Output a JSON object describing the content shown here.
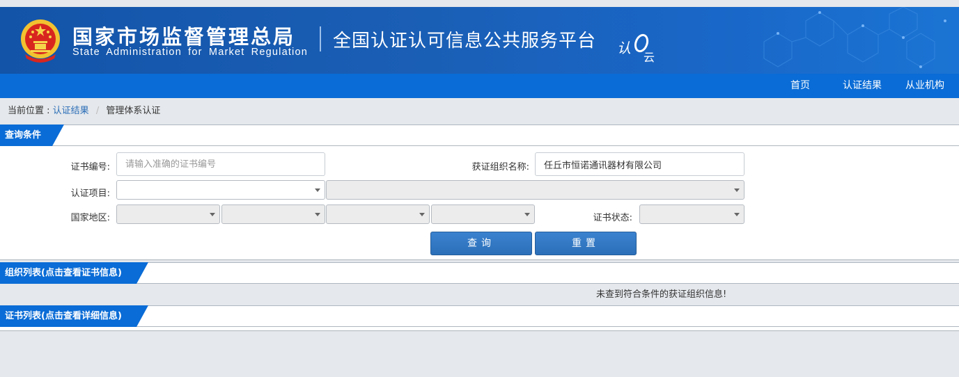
{
  "header": {
    "org_name_cn": "国家市场监督管理总局",
    "org_name_en": "State Administration for Market Regulation",
    "platform_name": "全国认证认可信息公共服务平台",
    "logo_text": "认云"
  },
  "nav": {
    "items": [
      {
        "label": "首页"
      },
      {
        "label": "认证结果"
      },
      {
        "label": "从业机构"
      }
    ]
  },
  "breadcrumb": {
    "prefix": "当前位置 :",
    "link": "认证结果",
    "separator": "/",
    "current": "管理体系认证"
  },
  "query": {
    "title": "查询条件",
    "cert_no_label": "证书编号:",
    "cert_no_placeholder": "请输入准确的证书编号",
    "org_name_label": "获证组织名称:",
    "org_name_value": "任丘市恒诺通讯器材有限公司",
    "project_label": "认证项目:",
    "region_label": "国家地区:",
    "status_label": "证书状态:",
    "search_button": "查询",
    "reset_button": "重置"
  },
  "org_list": {
    "title": "组织列表(点击查看证书信息)",
    "empty_message": "未查到符合条件的获证组织信息!"
  },
  "cert_list": {
    "title": "证书列表(点击查看详细信息)"
  },
  "colors": {
    "banner": "#1a5fb6",
    "nav": "#0a6cd6",
    "button": "#2b6fb8",
    "link": "#2a6db7"
  }
}
